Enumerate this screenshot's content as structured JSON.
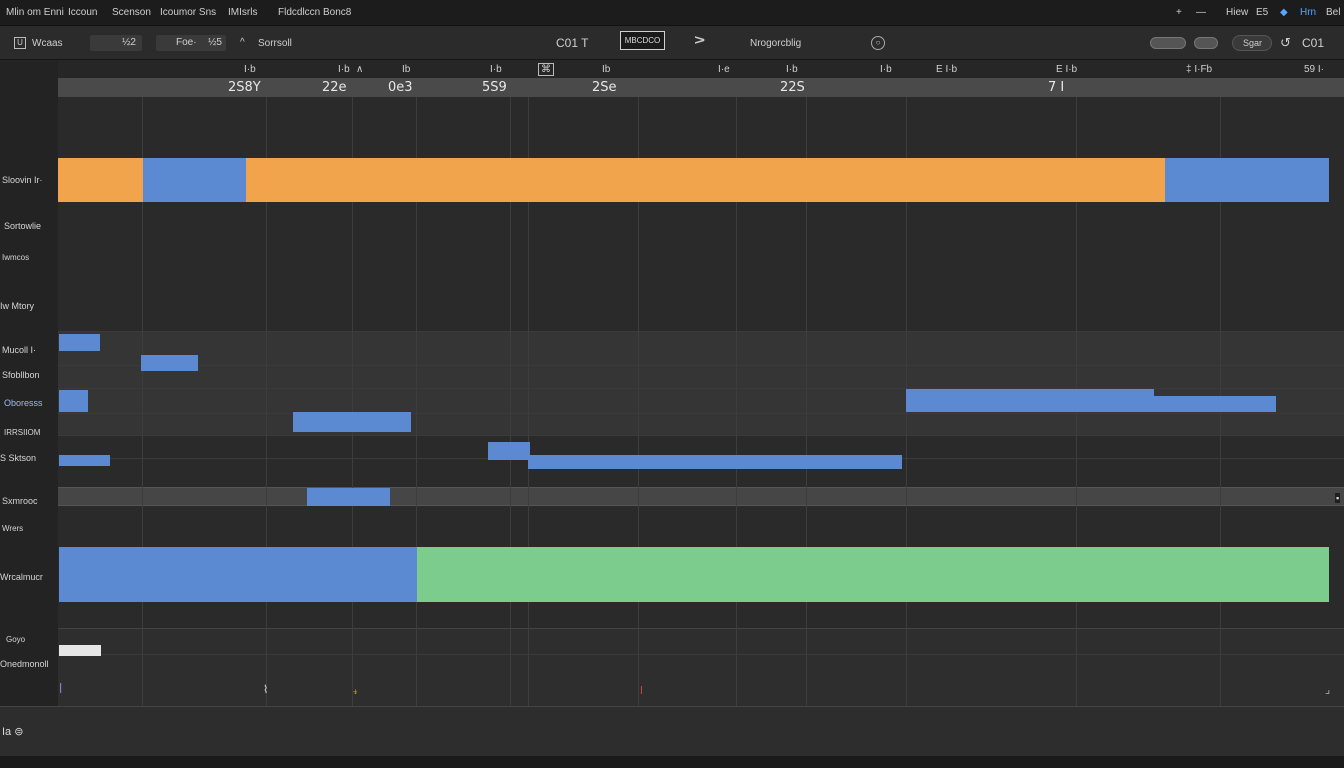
{
  "menu": [
    "Mlin om Enni",
    "Iccoun",
    "Scenson",
    "Icoumor Sns",
    "IMIsrls",
    "Fldcdlccn Bonc8"
  ],
  "tray": [
    "+",
    "—",
    "Hiew",
    "E5",
    "◆",
    "Hrn",
    "Bel"
  ],
  "toolbar": {
    "project": "Wcaas",
    "field_a": "½2",
    "field_b": "Foe·",
    "field_b_value": "½5",
    "scene_label": "Sorrsoll",
    "counter": "C01 T",
    "monitor_label": "MBCDCO",
    "play_glyph": "∧",
    "mode_label": "Nrogorcblig",
    "save_label": "Sgar",
    "time": "C01"
  },
  "ruler_labels": [
    "I·b",
    "I·b",
    "∧",
    "Ib",
    "I·b",
    "⌘",
    "Ib",
    "I·e",
    "I·b",
    "I·b",
    "E I·b",
    "E I·b",
    "‡ I·Fb",
    "59 I·"
  ],
  "timecodes": [
    "2S8Y",
    "22e",
    "0e3",
    "5S9",
    "2Se",
    "22S",
    "7 I"
  ],
  "tracks": [
    "Sloovin Ir·",
    "Sortowlie",
    "Iwmcos",
    "Iw Mtory",
    "Mucoll I·",
    "Sfobllbon",
    "Oboresss",
    "IRRSIIOM",
    "S Sktson",
    "Sxmrooc",
    "Wrers",
    "Wrcalmucr",
    "Goyo",
    "Onedmonoll"
  ],
  "bottom": {
    "label": "Ia ⊜"
  },
  "colors": {
    "orange": "#f2a44c",
    "blue": "#5b8ad2",
    "green": "#7ccc8e",
    "white": "#e6e6e6"
  }
}
